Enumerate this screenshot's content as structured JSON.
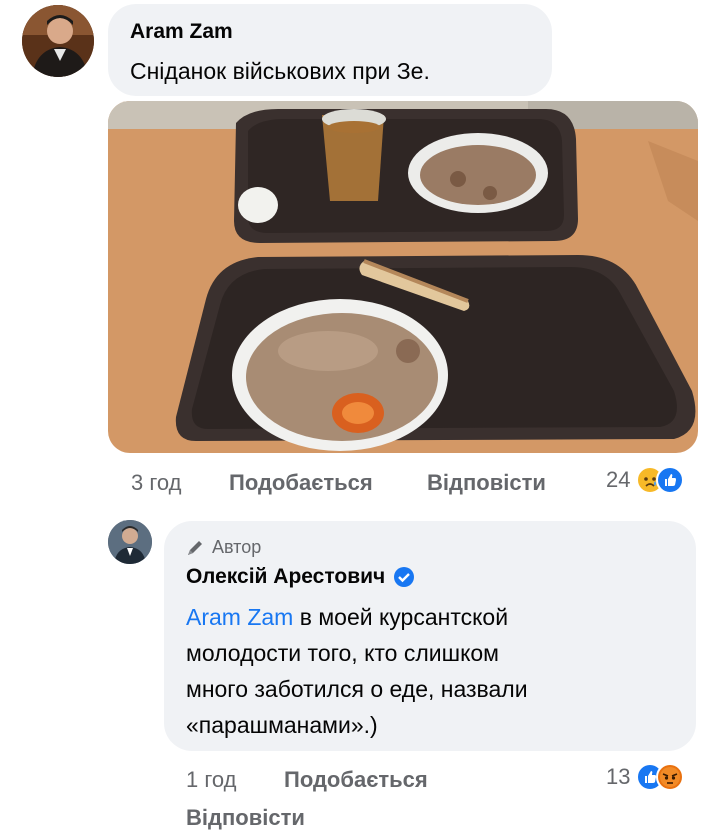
{
  "comment1": {
    "author": "Aram Zam",
    "text": "Сніданок військових при Зе.",
    "time": "3 год",
    "like_label": "Подобається",
    "reply_label": "Відповісти",
    "reaction_count": "24",
    "reactions": [
      "sad-reaction",
      "like-reaction"
    ]
  },
  "comment2": {
    "badge_label": "Автор",
    "author": "Олексій Арестович",
    "mention": "Aram Zam",
    "text_line1": " в моей курсантской",
    "text_line2": "молодости того, кто слишком",
    "text_line3": "много заботился о еде, назвали",
    "text_line4": "«парашманами».)",
    "time": "1 год",
    "like_label": "Подобається",
    "reply_label": "Відповісти",
    "reaction_count": "13",
    "reactions": [
      "like-reaction",
      "angry-reaction"
    ]
  },
  "colors": {
    "bubble": "#f0f2f5",
    "meta_text": "#65676b",
    "link": "#1877f2",
    "like_blue": "#1877f2",
    "sad_yellow": "#f7b928",
    "angry_orange": "#e9710f"
  }
}
